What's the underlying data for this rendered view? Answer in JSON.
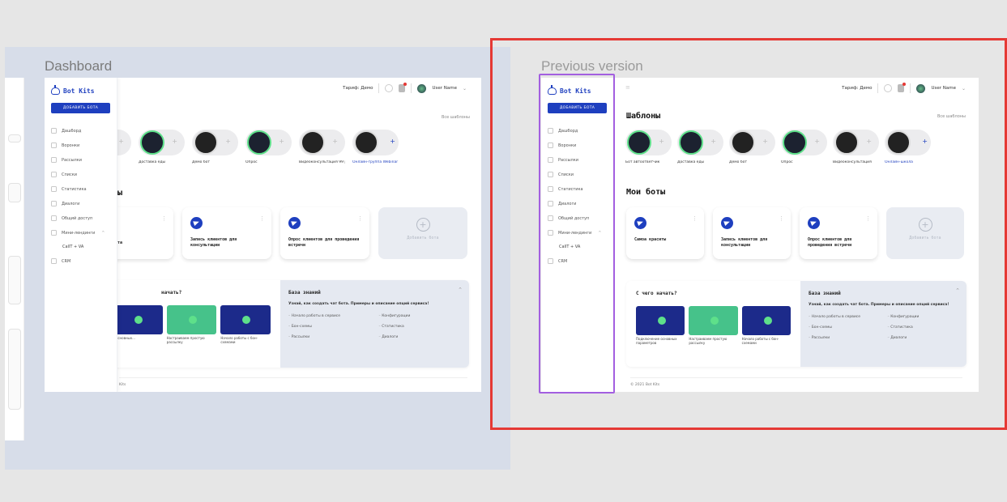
{
  "frames": {
    "dashboard_label": "Dashboard",
    "previous_label": "Previous version"
  },
  "app": {
    "logo": "Bot Kits",
    "add_bot_btn": "ДОБАВИТЬ БОТА",
    "tariff": "Тариф: Демо",
    "user_name": "User Name",
    "nav": [
      {
        "label": "Дашборд"
      },
      {
        "label": "Воронки"
      },
      {
        "label": "Рассылки"
      },
      {
        "label": "Списки"
      },
      {
        "label": "Статистика"
      },
      {
        "label": "Диалоги"
      },
      {
        "label": "Общий доступ"
      },
      {
        "label": "Мини-лендинги"
      },
      {
        "label": "CallT + VA"
      },
      {
        "label": "CRM"
      }
    ],
    "templates_title": "Шаблоны",
    "all_templates": "Все шаблоны",
    "templates": [
      {
        "label": "Бот автоответчик"
      },
      {
        "label": "Доставка еды"
      },
      {
        "label": "Демо бот"
      },
      {
        "label": "Опрос"
      },
      {
        "label": "Видеоконсультация"
      },
      {
        "label": "Онлайн-школа"
      }
    ],
    "templates_dashboard": [
      {
        "label": ""
      },
      {
        "label": "Доставка еды"
      },
      {
        "label": "Демо бот"
      },
      {
        "label": "Опрос"
      },
      {
        "label": "Видеоконсультация 99 ру..."
      },
      {
        "label": "Онлайн-группа Webinar"
      }
    ],
    "my_bots_title": "Мои боты",
    "my_bots_title_partial": "оты",
    "bots": [
      {
        "name": "Самоа краситы"
      },
      {
        "name": "Запись клиентов для консультации"
      },
      {
        "name": "Опрос клиентов для проведения встречи"
      }
    ],
    "bot_dashboard_first": "ента",
    "add_bot_card": "Добавить бота",
    "start_title": "С чего начать?",
    "start_title_partial": "начать?",
    "videos": [
      {
        "title": "Подключение основных параметров"
      },
      {
        "title": "Настраиваем простую рассылку"
      },
      {
        "title": "Начало работы с бон-схемами"
      }
    ],
    "videos_dashboard": [
      {
        "title": "и основных..."
      },
      {
        "title": "Настраиваем простую рассылку"
      },
      {
        "title": "Начало работы с бон-схемами"
      }
    ],
    "kb_title": "База знаний",
    "kb_sub": "Узнай, как создать чат бота. Примеры и описание опций сервиса!",
    "kb_links": [
      {
        "label": "Начало работы в сервисе"
      },
      {
        "label": "Конфигурации"
      },
      {
        "label": "Бон-схемы"
      },
      {
        "label": "Статистика"
      },
      {
        "label": "Рассылки"
      },
      {
        "label": "Диалоги"
      }
    ],
    "footer": "© 2021 Bot Kits",
    "footer_partial": "Kits"
  },
  "colors": {
    "brand": "#1e3fbf",
    "accent_green": "#5ee08a",
    "highlight_red": "#e53935",
    "highlight_purple": "#a35fe0",
    "dashboard_bg": "#d7dde9"
  }
}
